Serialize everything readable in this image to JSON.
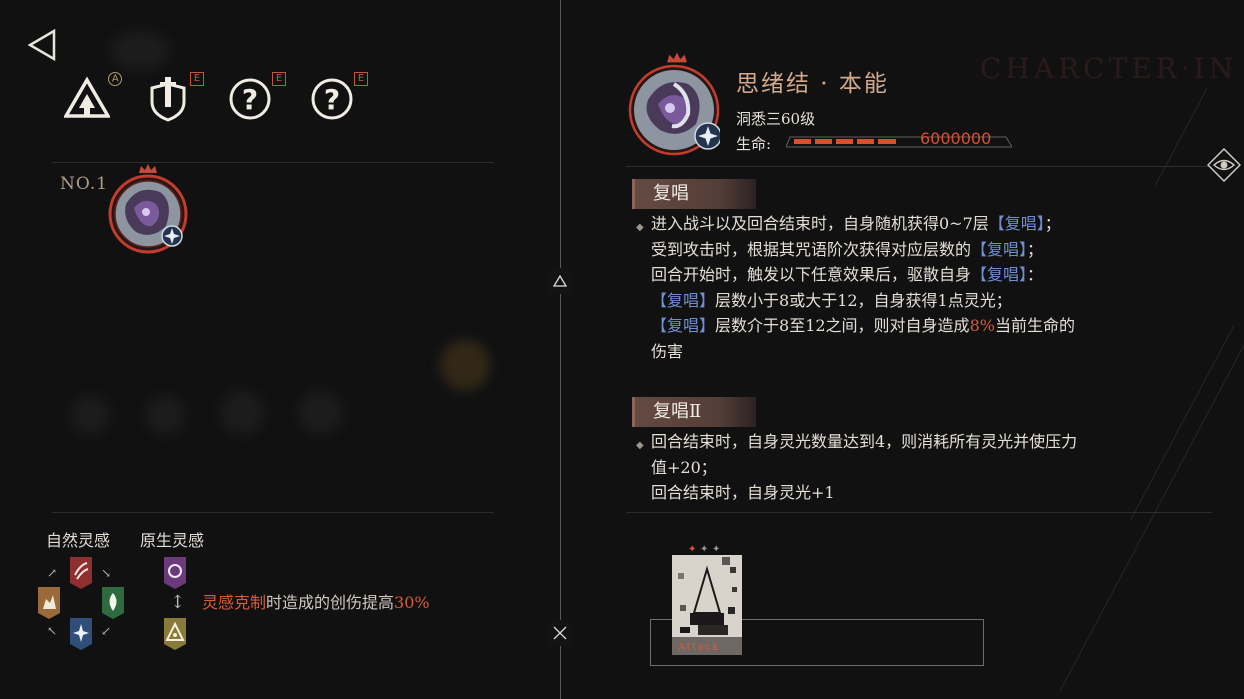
{
  "left": {
    "status_icons": [
      {
        "icon": "level-up-icon",
        "badge": "A"
      },
      {
        "icon": "shield-icon",
        "badge": "E"
      },
      {
        "icon": "unknown-icon",
        "badge": "E"
      },
      {
        "icon": "unknown-icon",
        "badge": "E"
      }
    ],
    "enemy_number": "NO.1",
    "inspiration": {
      "natural_label": "自然灵感",
      "origin_label": "原生灵感",
      "advantage_keyword": "灵感克制",
      "advantage_text": "时造成的创伤提高",
      "advantage_value": "30%"
    }
  },
  "right": {
    "name": "思绪结 · 本能",
    "level": "洞悉三60级",
    "life_label": "生命:",
    "life_value": "6000000",
    "watermark": "CHARCTER·IN",
    "skills": [
      {
        "title": "复唱",
        "lines": [
          {
            "pre": "进入战斗以及回合结束时，自身随机获得0~7层",
            "kw": "【复唱】",
            "post": "；"
          },
          {
            "pre": "受到攻击时，根据其咒语阶次获得对应层数的",
            "kw": "【复唱】",
            "post": "；"
          },
          {
            "pre": "回合开始时，触发以下任意效果后，驱散自身",
            "kw": "【复唱】",
            "post": "："
          },
          {
            "pre": "",
            "kw": "【复唱】",
            "post": "层数小于8或大于12，自身获得1点灵光；"
          },
          {
            "pre": "",
            "kw": "【复唱】",
            "post": "层数介于8至12之间，则对自身造成",
            "pct": "8%",
            "post2": "当前生命的"
          },
          {
            "pre": "伤害",
            "kw": "",
            "post": ""
          }
        ]
      },
      {
        "title": "复唱Ⅱ",
        "lines": [
          {
            "pre": "回合结束时，自身灵光数量达到4，则消耗所有灵光并使压力",
            "kw": "",
            "post": ""
          },
          {
            "pre": "值+20；",
            "kw": "",
            "post": ""
          },
          {
            "pre": "回合结束时，自身灵光+1",
            "kw": "",
            "post": ""
          }
        ]
      }
    ],
    "card_label": "Attack"
  },
  "colors": {
    "accent_red": "#d65c3a",
    "name_gold": "#d2a989",
    "keyword_blue": "#6f8fcf"
  }
}
